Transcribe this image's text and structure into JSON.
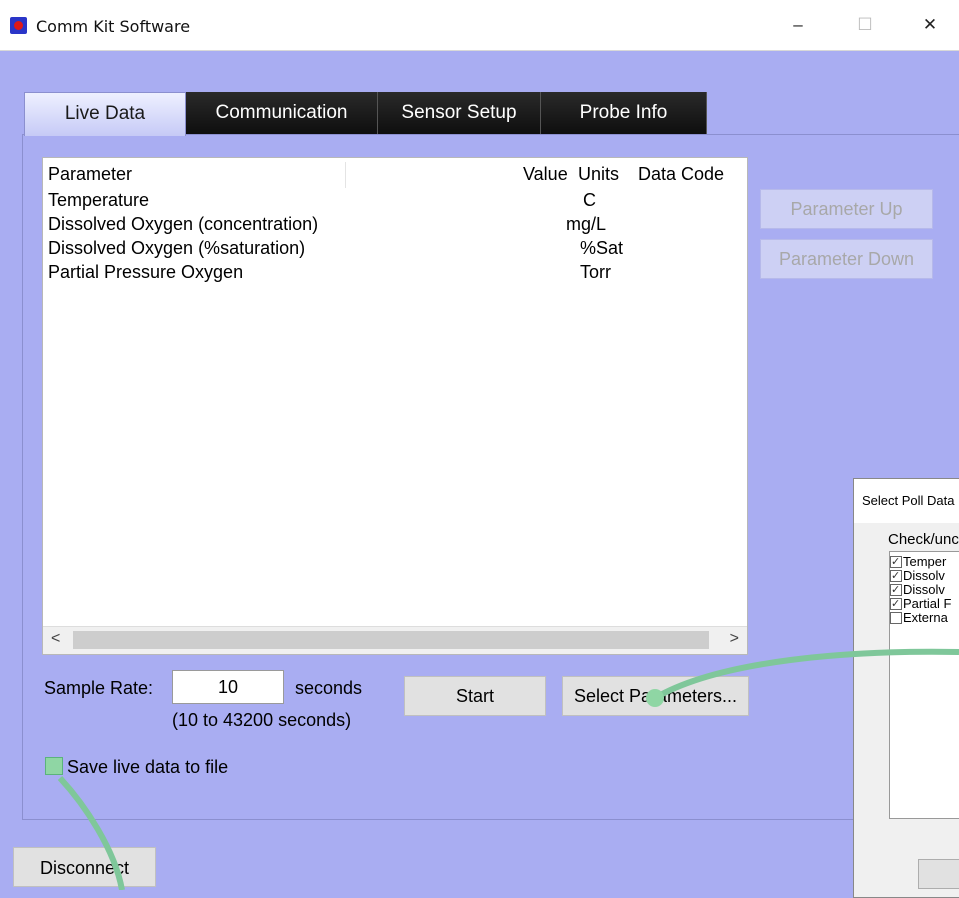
{
  "window": {
    "title": "Comm Kit Software",
    "minimize_glyph": "–",
    "maximize_glyph": "☐",
    "close_glyph": "✕"
  },
  "tabs": [
    {
      "label": "Live Data",
      "active": true
    },
    {
      "label": "Communication",
      "active": false
    },
    {
      "label": "Sensor Setup",
      "active": false
    },
    {
      "label": "Probe Info",
      "active": false
    }
  ],
  "parameter_list": {
    "columns": [
      "Parameter",
      "Value",
      "Units",
      "Data Code"
    ],
    "rows": [
      {
        "parameter": "Temperature",
        "value": "",
        "units": "C",
        "data_code": ""
      },
      {
        "parameter": "Dissolved Oxygen (concentration)",
        "value": "",
        "units": "mg/L",
        "data_code": ""
      },
      {
        "parameter": "Dissolved Oxygen (%saturation)",
        "value": "",
        "units": "%Sat",
        "data_code": ""
      },
      {
        "parameter": "Partial Pressure Oxygen",
        "value": "",
        "units": "Torr",
        "data_code": ""
      }
    ],
    "scroll_left_glyph": "<",
    "scroll_right_glyph": ">"
  },
  "side_buttons": {
    "parameter_up": "Parameter Up",
    "parameter_down": "Parameter Down"
  },
  "sampling": {
    "sample_rate_label": "Sample Rate:",
    "sample_rate_value": "10",
    "seconds_label": "seconds",
    "range_hint": "(10 to 43200 seconds)",
    "start_button": "Start",
    "select_parameters_button": "Select Parameters..."
  },
  "save_to_file": {
    "label": "Save live data to file",
    "checked": false
  },
  "disconnect_button": "Disconnect",
  "poll_dialog": {
    "title": "Select Poll Data",
    "instruction": "Check/unc",
    "items": [
      {
        "label": "Temper",
        "checked": true
      },
      {
        "label": "Dissolv",
        "checked": true
      },
      {
        "label": "Dissolv",
        "checked": true
      },
      {
        "label": "Partial F",
        "checked": true
      },
      {
        "label": "Externa",
        "checked": false
      }
    ]
  },
  "colors": {
    "background": "#a9adf2",
    "tab_dark": "#1a1a1a",
    "highlight_marker": "#8fd6a4",
    "connector_line": "#7fc79a"
  }
}
